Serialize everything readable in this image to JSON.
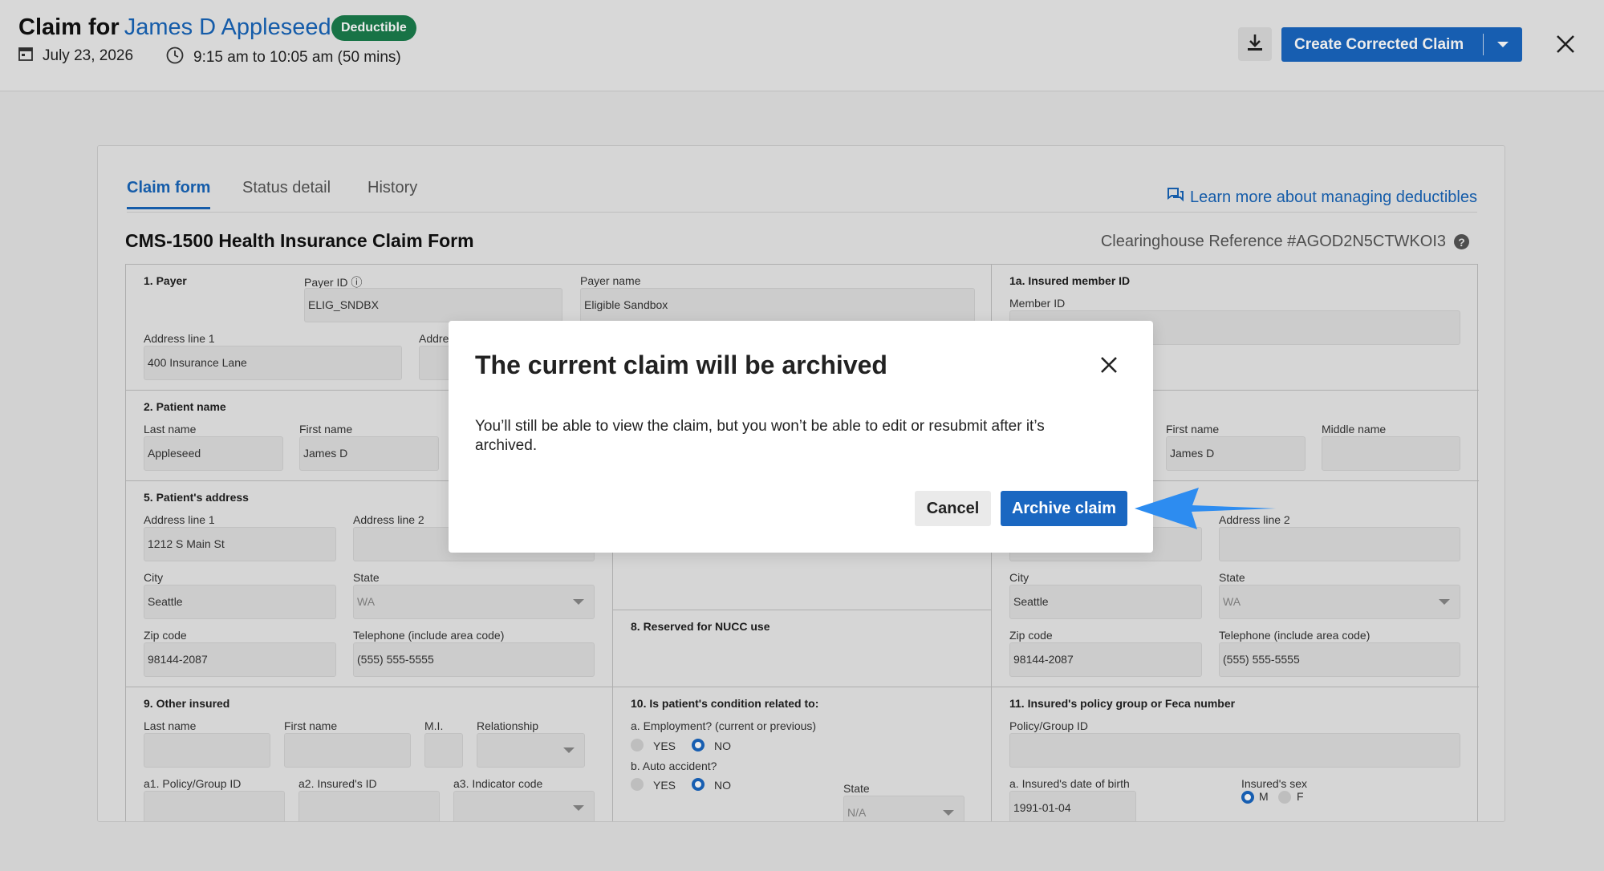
{
  "header": {
    "title_prefix": "Claim for",
    "patient_name": "James D Appleseed",
    "badge": "Deductible",
    "date": "July 23, 2026",
    "time": "9:15 am to 10:05 am (50 mins)",
    "create_button": "Create Corrected Claim"
  },
  "tabs": [
    {
      "label": "Claim form",
      "active": true
    },
    {
      "label": "Status detail",
      "active": false
    },
    {
      "label": "History",
      "active": false
    }
  ],
  "learn_link": "Learn more about managing deductibles",
  "form": {
    "title": "CMS-1500 Health Insurance Claim Form",
    "reference": "Clearinghouse Reference #AGOD2N5CTWKOI3",
    "payer": {
      "section": "1. Payer",
      "payer_id_label": "Payer ID",
      "payer_id": "ELIG_SNDBX",
      "payer_name_label": "Payer name",
      "payer_name": "Eligible Sandbox",
      "address1_label": "Address line 1",
      "address1": "400 Insurance Lane",
      "address2_label": "Addre"
    },
    "insured_member": {
      "section": "1a. Insured member ID",
      "member_id_label": "Member ID",
      "member_id": ""
    },
    "patient_name": {
      "section": "2. Patient name",
      "last_label": "Last name",
      "last": "Appleseed",
      "first_label": "First name",
      "first": "James D"
    },
    "insured_name": {
      "first_label": "First name",
      "first": "James D",
      "middle_label": "Middle name",
      "middle": ""
    },
    "patient_address": {
      "section": "5. Patient's address",
      "address1_label": "Address line 1",
      "address1": "1212 S Main St",
      "address2_label": "Address line 2",
      "address2": "",
      "city_label": "City",
      "city": "Seattle",
      "state_label": "State",
      "state": "WA",
      "zip_label": "Zip code",
      "zip": "98144-2087",
      "phone_label": "Telephone (include area code)",
      "phone": "(555) 555-5555"
    },
    "reserved": {
      "section": "8. Reserved for NUCC use"
    },
    "insured_address": {
      "address2_label": "Address line 2",
      "address2": "",
      "city_label": "City",
      "city": "Seattle",
      "state_label": "State",
      "state": "WA",
      "zip_label": "Zip code",
      "zip": "98144-2087",
      "phone_label": "Telephone (include area code)",
      "phone": "(555) 555-5555"
    },
    "other_insured": {
      "section": "9. Other insured",
      "last_label": "Last name",
      "first_label": "First name",
      "mi_label": "M.I.",
      "relationship_label": "Relationship",
      "policy_label": "a1. Policy/Group ID",
      "insured_id_label": "a2. Insured's ID",
      "indicator_label": "a3. Indicator code"
    },
    "condition": {
      "section": "10. Is patient's condition related to:",
      "employment_label": "a. Employment? (current or previous)",
      "auto_label": "b. Auto accident?",
      "yes": "YES",
      "no": "NO",
      "state_label": "State",
      "state": "N/A"
    },
    "policy_group": {
      "section": "11. Insured's policy group or Feca number",
      "policy_label": "Policy/Group ID",
      "policy": "",
      "dob_label": "a. Insured's date of birth",
      "dob": "1991-01-04",
      "sex_label": "Insured's sex",
      "male": "M",
      "female": "F"
    }
  },
  "modal": {
    "title": "The current claim will be archived",
    "body": "You’ll still be able to view the claim, but you won’t be able to edit or resubmit after it’s archived.",
    "cancel": "Cancel",
    "archive": "Archive claim"
  },
  "colors": {
    "accent": "#1a67c1",
    "badge": "#1b7d4c",
    "arrow": "#2d8cf0"
  }
}
